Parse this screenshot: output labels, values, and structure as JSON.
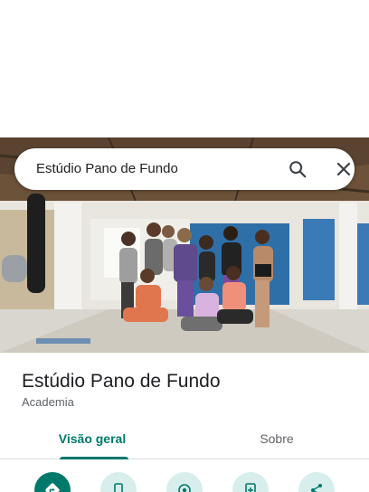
{
  "search": {
    "query": "Estúdio Pano de Fundo"
  },
  "place": {
    "name": "Estúdio Pano de Fundo",
    "category": "Academia"
  },
  "tabs": [
    {
      "label": "Visão geral",
      "selected": true
    },
    {
      "label": "Sobre",
      "selected": false
    }
  ],
  "actions": [
    {
      "icon": "directions-icon"
    },
    {
      "icon": "phone-icon"
    },
    {
      "icon": "locate-icon"
    },
    {
      "icon": "save-icon"
    },
    {
      "icon": "share-icon"
    }
  ],
  "colors": {
    "accent": "#00796b",
    "accent_light": "#d7eeec",
    "text_primary": "#202124",
    "text_secondary": "#5f6368"
  }
}
